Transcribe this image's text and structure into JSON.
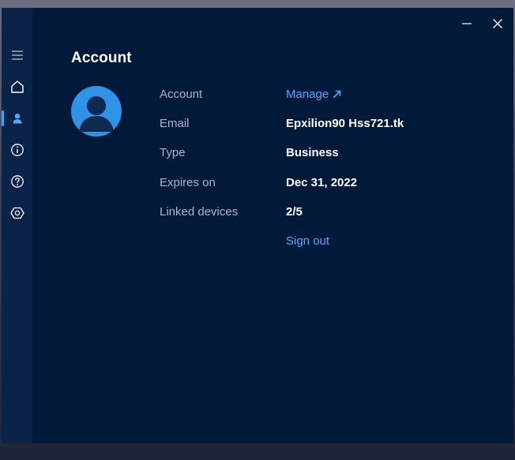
{
  "window": {
    "minimize_icon": "minimize-icon",
    "close_icon": "close-icon"
  },
  "sidebar": {
    "items": [
      {
        "icon": "hamburger-menu-icon"
      },
      {
        "icon": "home-icon"
      },
      {
        "icon": "person-icon",
        "active": true
      },
      {
        "icon": "info-icon"
      },
      {
        "icon": "help-icon"
      },
      {
        "icon": "settings-icon"
      }
    ]
  },
  "page": {
    "title": "Account"
  },
  "account": {
    "rows": [
      {
        "label": "Account",
        "value": "Manage",
        "link": true,
        "icon": "external-link-arrow-icon"
      },
      {
        "label": "Email",
        "value": "Epxilion90 Hss721.tk"
      },
      {
        "label": "Type",
        "value": "Business"
      },
      {
        "label": "Expires on",
        "value": "Dec 31, 2022"
      },
      {
        "label": "Linked devices",
        "value": "2/5"
      }
    ],
    "sign_out": "Sign out"
  },
  "colors": {
    "window_bg": "#021a3a",
    "sidebar_bg": "#0b2348",
    "accent": "#52a8ff",
    "avatar_bg": "#2f94e8",
    "label": "#a9b6c8",
    "value": "#ffffff"
  }
}
